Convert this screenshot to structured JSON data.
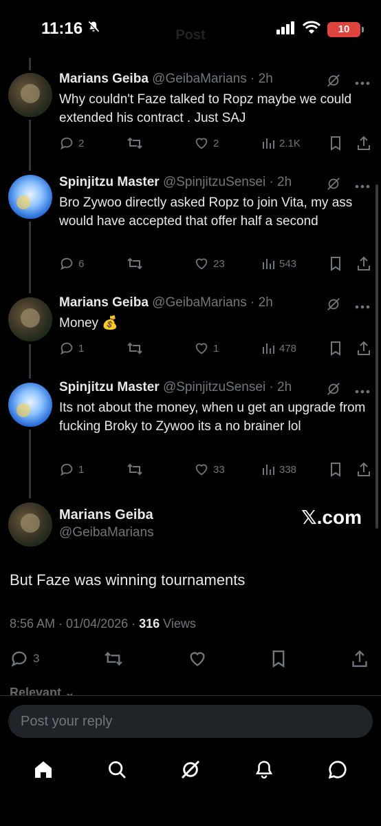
{
  "status_bar": {
    "time": "11:16",
    "battery": "10",
    "ghost_title": "Post"
  },
  "replies": [
    {
      "name": "Marians Geiba",
      "handle": "@GeibaMarians · 2h",
      "text": "Why couldn't Faze talked to Ropz maybe we could extended his contract . Just SAJ",
      "replies": "2",
      "reposts": "",
      "likes": "2",
      "views": "2.1K",
      "avatar": "marians"
    },
    {
      "name": "Spinjitzu Master",
      "handle": "@SpinjitzuSensei · 2h",
      "text": "Bro Zywoo directly asked Ropz to join Vita, my ass would have accepted that offer half a second",
      "replies": "6",
      "reposts": "",
      "likes": "23",
      "views": "543",
      "avatar": "spin"
    },
    {
      "name": "Marians Geiba",
      "handle": "@GeibaMarians · 2h",
      "text": "Money 💰",
      "replies": "1",
      "reposts": "",
      "likes": "1",
      "views": "478",
      "avatar": "marians"
    },
    {
      "name": "Spinjitzu Master",
      "handle": "@SpinjitzuSensei · 2h",
      "text": "Its not about the money, when u get an upgrade from fucking Broky to Zywoo its a no brainer lol",
      "replies": "1",
      "reposts": "",
      "likes": "33",
      "views": "338",
      "avatar": "spin"
    }
  ],
  "main_post": {
    "name": "Marians Geiba",
    "handle": "@GeibaMarians",
    "watermark": "𝕏.com",
    "text": "But Faze was winning tournaments",
    "timestamp": "8:56 AM · 01/04/2026 · ",
    "views_count": "316",
    "views_label": " Views",
    "replies": "3"
  },
  "relevant_label": "Relevant ⌄",
  "reply_box": {
    "placeholder": "Post your reply"
  },
  "tabbar": [
    "home-icon",
    "search-icon",
    "grok-icon",
    "notifications-icon",
    "messages-icon"
  ],
  "colors": {
    "background": "#000000",
    "text": "#e7e9ea",
    "muted": "#71767b",
    "battery": "#e0443e"
  }
}
